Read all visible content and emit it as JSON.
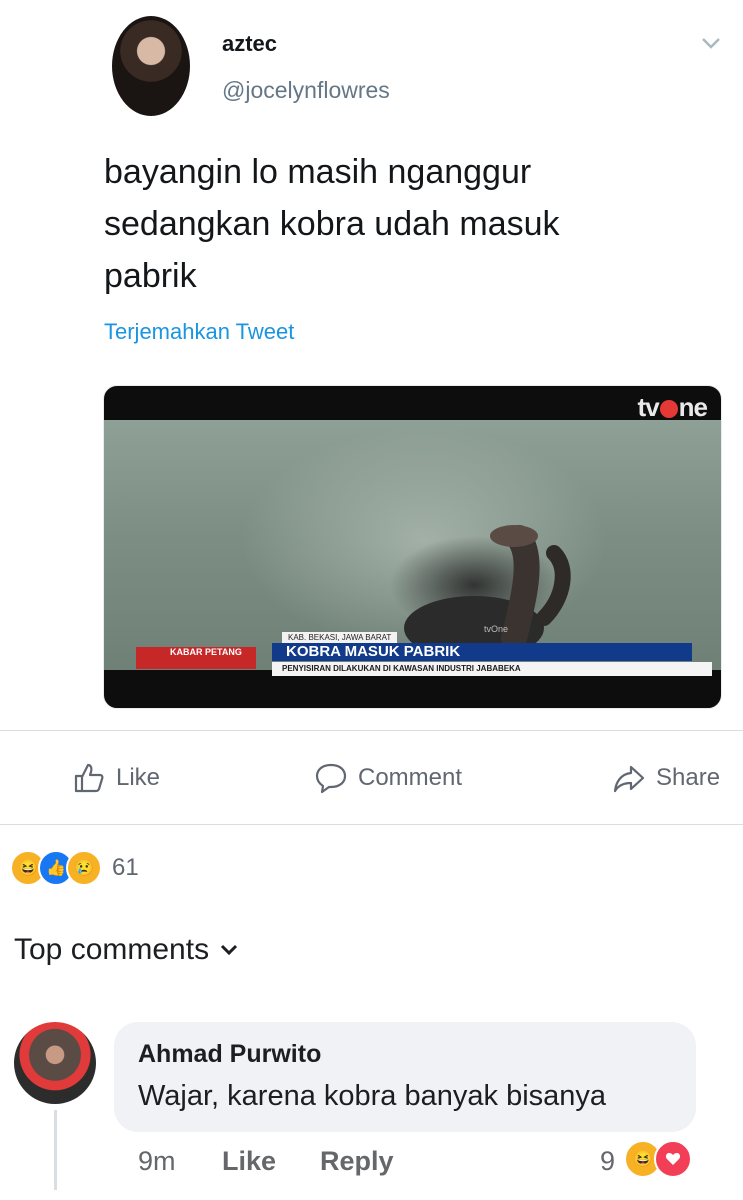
{
  "tweet": {
    "author_name": "aztec",
    "author_handle": "@jocelynflowres",
    "text": "bayangin lo masih nganggur\nsedangkan kobra udah masuk\npabrik",
    "translate_label": "Terjemahkan Tweet",
    "media": {
      "channel_logo_left": "tv",
      "channel_logo_right": "ne",
      "watermark": "tvOne",
      "program": "KABAR PETANG",
      "location": "KAB. BEKASI, JAWA BARAT",
      "headline": "KOBRA MASUK PABRIK",
      "subheadline": "PENYISIRAN DILAKUKAN DI KAWASAN INDUSTRI JABABEKA"
    }
  },
  "actions": {
    "like": "Like",
    "comment": "Comment",
    "share": "Share"
  },
  "reactions": {
    "icons": [
      "haha-icon",
      "like-icon",
      "sad-icon"
    ],
    "count": "61"
  },
  "comments_header": "Top comments",
  "comment": {
    "author": "Ahmad Purwito",
    "text": "Wajar, karena kobra banyak bisanya",
    "time": "9m",
    "like_label": "Like",
    "reply_label": "Reply",
    "reaction_count": "9",
    "reaction_icons": [
      "haha-icon",
      "love-icon"
    ]
  },
  "colors": {
    "link": "#1b95e0",
    "fb_blue": "#1877f2",
    "secondary_text": "#65676b"
  }
}
